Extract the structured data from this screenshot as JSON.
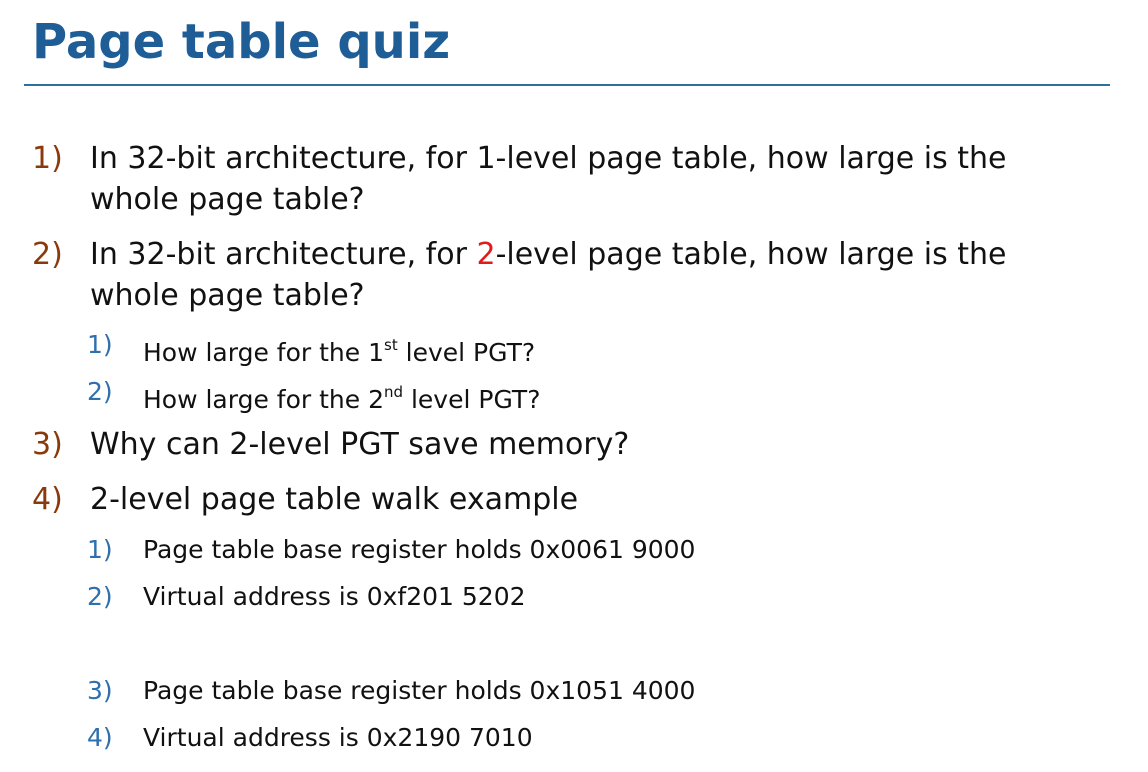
{
  "slide": {
    "title": "Page table quiz"
  },
  "q1": {
    "num": "1)",
    "line1": "In 32-bit architecture, for 1-level page table, how large is the",
    "line2": "whole page table?"
  },
  "q2": {
    "num": "2)",
    "line1_pre": "In 32-bit architecture, for ",
    "line1_hl": "2",
    "line1_post": "-level page table, how large is the",
    "line2": "whole page table?",
    "subs": [
      {
        "num": "1)",
        "pre": "How large for the 1",
        "sup": "st",
        "post": " level PGT?"
      },
      {
        "num": "2)",
        "pre": "How large for the 2",
        "sup": "nd",
        "post": " level PGT?"
      }
    ]
  },
  "q3": {
    "num": "3)",
    "text": "Why can 2-level PGT save memory?"
  },
  "q4": {
    "num": "4)",
    "text": "2-level page table walk example",
    "subs": [
      {
        "num": "1)",
        "text": "Page table base register holds 0x0061 9000"
      },
      {
        "num": "2)",
        "text": "Virtual address is 0xf201 5202"
      },
      {
        "num": "3)",
        "text": "Page table base register holds 0x1051 4000"
      },
      {
        "num": "4)",
        "text": "Virtual address is 0x2190 7010"
      }
    ]
  },
  "colors": {
    "title": "#1f5d97",
    "main_number": "#8a3a0a",
    "sub_number": "#2f6fae",
    "highlight": "#e01b1b"
  }
}
